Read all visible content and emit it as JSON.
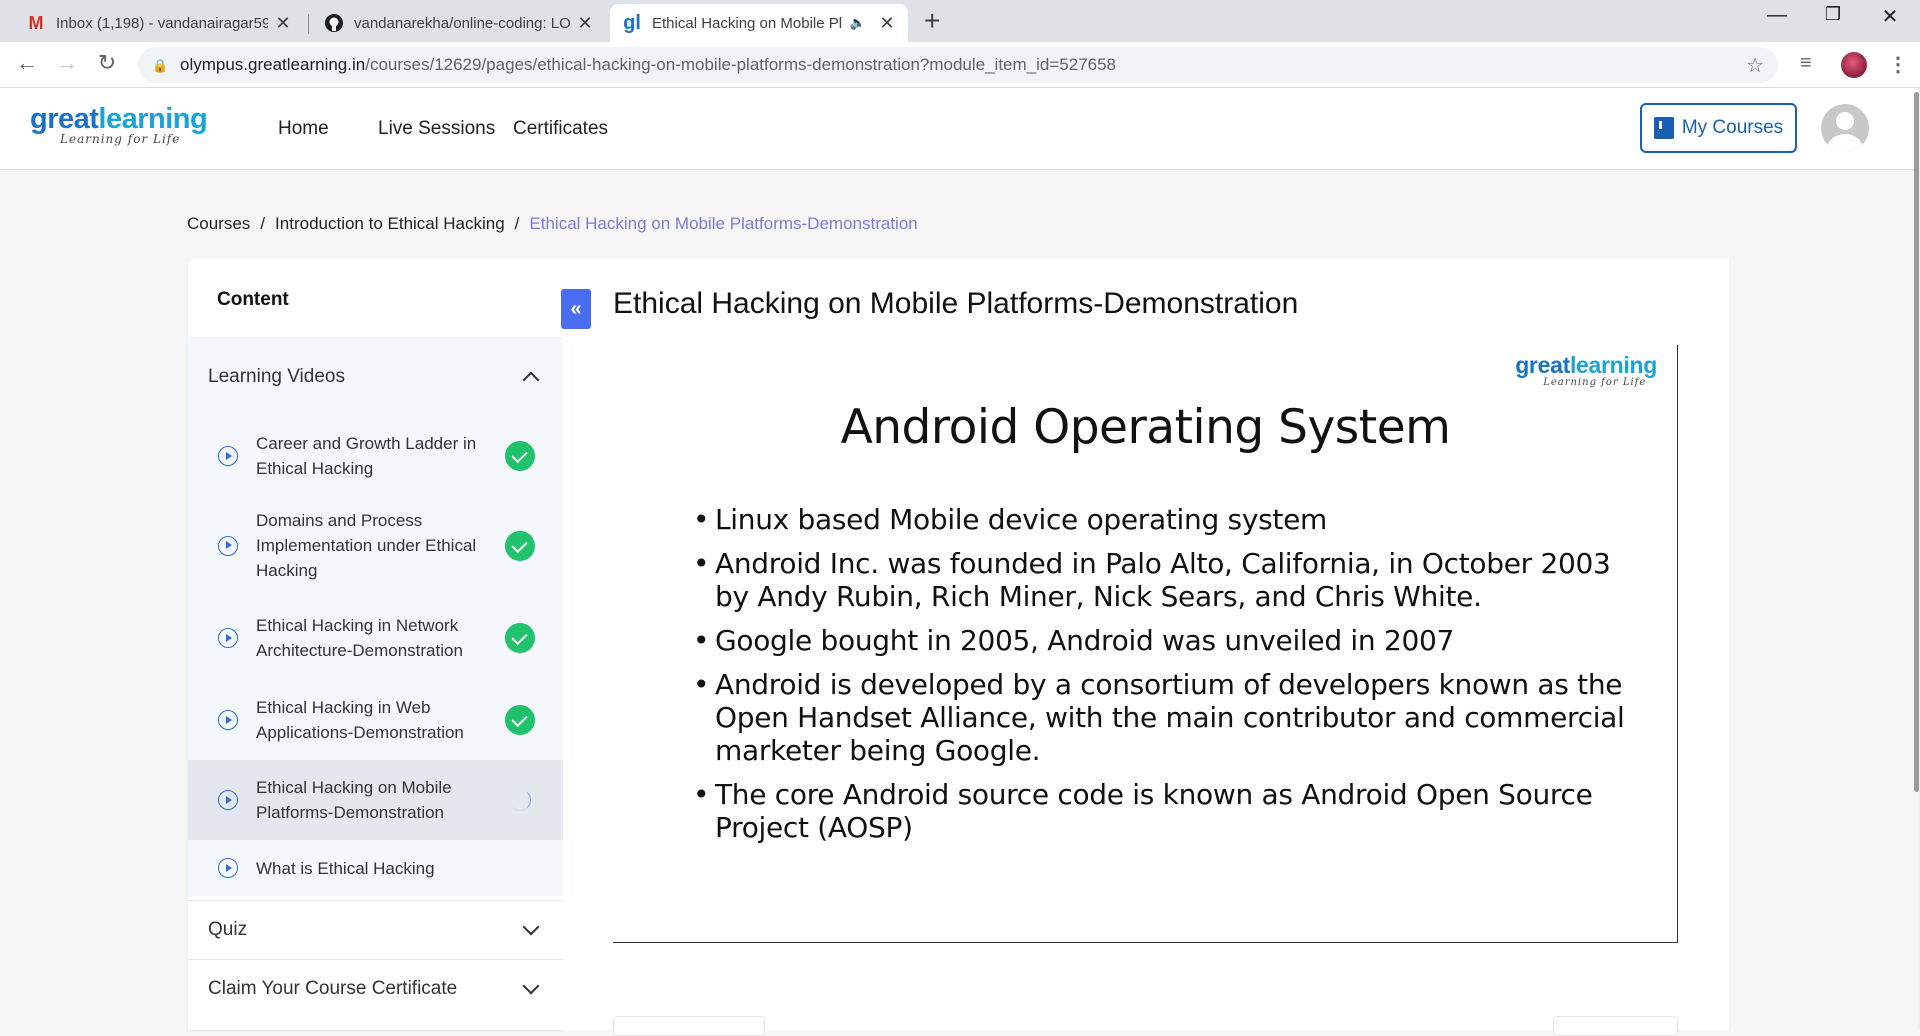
{
  "browser": {
    "tabs": [
      {
        "title": "Inbox (1,198) - vandanairagar59@",
        "favicon": "gmail-icon",
        "close": "✕"
      },
      {
        "title": "vandanarekha/online-coding: LO",
        "favicon": "github-icon",
        "close": "✕"
      },
      {
        "title": "Ethical Hacking on Mobile Pl",
        "favicon": "greatlearning-icon",
        "close": "✕"
      }
    ],
    "url_host": "olympus.greatlearning.in",
    "url_path": "/courses/12629/pages/ethical-hacking-on-mobile-platforms-demonstration?module_item_id=527658"
  },
  "site": {
    "logo_brand_a": "great",
    "logo_brand_b": "learning",
    "logo_tagline": "Learning for Life",
    "nav": [
      "Home",
      "Live Sessions",
      "Certificates"
    ],
    "my_courses": "My Courses"
  },
  "breadcrumb": {
    "items": [
      "Courses",
      "Introduction to Ethical Hacking"
    ],
    "separator": "/",
    "current": "Ethical Hacking on Mobile Platforms-Demonstration"
  },
  "sidebar": {
    "title": "Content",
    "section": "Learning Videos",
    "items": [
      {
        "label": "Career and Growth Ladder in Ethical Hacking",
        "status": "completed"
      },
      {
        "label": "Domains and Process Implementation under Ethical Hacking",
        "status": "completed"
      },
      {
        "label": "Ethical Hacking in Network Architecture-Demonstration",
        "status": "completed"
      },
      {
        "label": "Ethical Hacking in Web Applications-Demonstration",
        "status": "completed"
      },
      {
        "label": "Ethical Hacking on Mobile Platforms-Demonstration",
        "status": "in-progress"
      },
      {
        "label": "What is Ethical Hacking",
        "status": "none"
      }
    ],
    "quiz": "Quiz",
    "certificate": "Claim Your Course Certificate"
  },
  "main": {
    "collapse_glyph": "«",
    "title": "Ethical Hacking on Mobile Platforms-Demonstration",
    "slide": {
      "logo_brand_a": "great",
      "logo_brand_b": "learning",
      "logo_tagline": "Learning for Life",
      "heading": "Android Operating System",
      "bullets": [
        "Linux based Mobile device operating system",
        "Android Inc. was founded in Palo Alto, California, in October 2003 by Andy Rubin, Rich Miner, Nick Sears, and Chris White.",
        "Google bought in 2005, Android was unveiled in 2007",
        "Android is developed by a consortium of developers known as the Open Handset Alliance, with the main contributor and commercial marketer being Google.",
        "The core Android source code is known as Android Open Source Project (AOSP)"
      ]
    }
  },
  "colors": {
    "accent_blue": "#1a5fb4",
    "breadcrumb_current": "#7c7bda",
    "complete_green": "#20c26b",
    "collapse_button": "#4a6cf0"
  }
}
